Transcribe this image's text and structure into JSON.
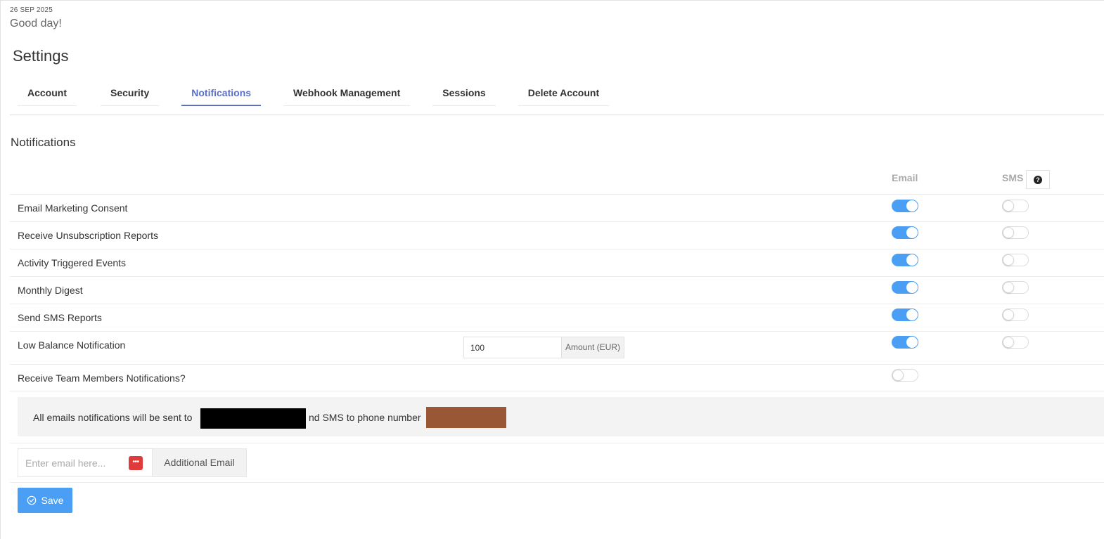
{
  "header": {
    "date": "26 SEP 2025",
    "greeting": "Good day!",
    "page_title": "Settings"
  },
  "tabs": [
    {
      "label": "Account",
      "active": false
    },
    {
      "label": "Security",
      "active": false
    },
    {
      "label": "Notifications",
      "active": true
    },
    {
      "label": "Webhook Management",
      "active": false
    },
    {
      "label": "Sessions",
      "active": false
    },
    {
      "label": "Delete Account",
      "active": false
    }
  ],
  "notifications": {
    "section_title": "Notifications",
    "col_email": "Email",
    "col_sms": "SMS",
    "help_icon": "question-circle-icon",
    "rows": [
      {
        "label": "Email Marketing Consent",
        "email": true,
        "sms": false
      },
      {
        "label": "Receive Unsubscription Reports",
        "email": true,
        "sms": false
      },
      {
        "label": "Activity Triggered Events",
        "email": true,
        "sms": false
      },
      {
        "label": "Monthly Digest",
        "email": true,
        "sms": false
      },
      {
        "label": "Send SMS Reports",
        "email": true,
        "sms": false
      },
      {
        "label": "Low Balance Notification",
        "email": true,
        "sms": false
      },
      {
        "label": "Receive Team Members Notifications?",
        "email": false
      }
    ],
    "low_balance": {
      "amount_value": "100",
      "amount_addon": "Amount (EUR)"
    }
  },
  "info": {
    "text_prefix": "All emails notifications will be sent to",
    "text_middle": "nd SMS to phone number"
  },
  "additional_email": {
    "placeholder": "Enter email here...",
    "addon": "Additional Email",
    "password_manager_icon": "password-manager-icon"
  },
  "actions": {
    "save_label": "Save",
    "save_icon": "check-circle-icon"
  },
  "colors": {
    "accent": "#4a9ff5",
    "active_tab": "#5b6fc7",
    "redaction_email": "#000000",
    "redaction_phone": "#9a5735"
  }
}
